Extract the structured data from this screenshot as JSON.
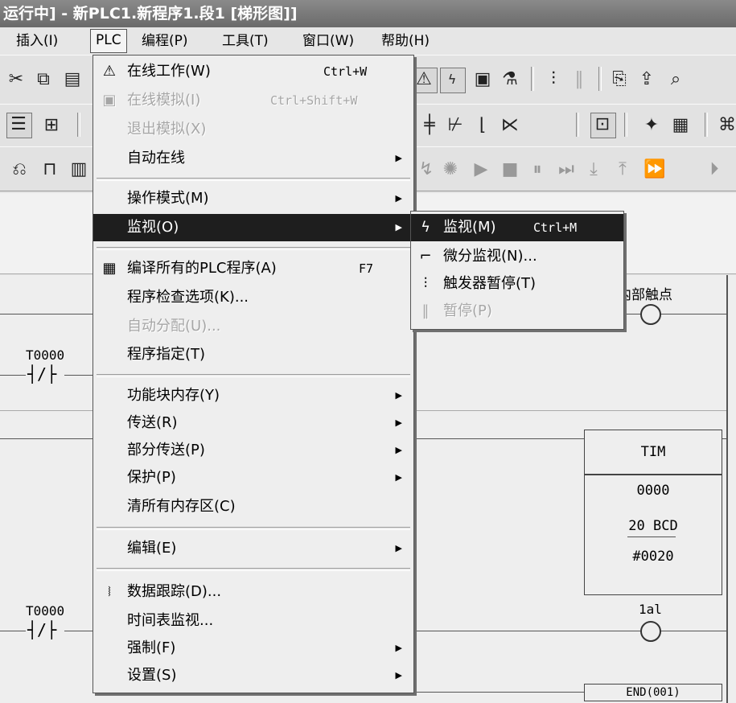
{
  "title": "运行中] - 新PLC1.新程序1.段1 [梯形图]]",
  "menubar": [
    "插入(I)",
    "PLC",
    "编程(P)",
    "工具(T)",
    "窗口(W)",
    "帮助(H)"
  ],
  "ladder": {
    "contact1": "T0000",
    "contact2": "T0000",
    "coil1": "内部触点",
    "coil2": "1al",
    "tim": {
      "name": "TIM",
      "num": "0000",
      "set": "20 BCD",
      "val": "#0020"
    },
    "end": "END(001)"
  },
  "plc_menu": [
    {
      "label": "在线工作(W)",
      "shortcut": "Ctrl+W",
      "icon": "online-work-icon",
      "disabled": false
    },
    {
      "label": "在线模拟(I)",
      "shortcut": "Ctrl+Shift+W",
      "icon": "simulate-icon",
      "disabled": true
    },
    {
      "label": "退出模拟(X)",
      "shortcut": "",
      "disabled": true
    },
    {
      "label": "自动在线",
      "submenu": true,
      "disabled": false
    },
    {
      "label": "操作模式(M)",
      "submenu": true,
      "disabled": false
    },
    {
      "label": "监视(O)",
      "submenu": true,
      "highlighted": true,
      "disabled": false
    },
    {
      "label": "编译所有的PLC程序(A)",
      "shortcut": "F7",
      "icon": "compile-icon",
      "disabled": false
    },
    {
      "label": "程序检查选项(K)...",
      "disabled": false
    },
    {
      "label": "自动分配(U)...",
      "disabled": true
    },
    {
      "label": "程序指定(T)",
      "disabled": false
    },
    {
      "label": "功能块内存(Y)",
      "submenu": true,
      "disabled": false
    },
    {
      "label": "传送(R)",
      "submenu": true,
      "disabled": false
    },
    {
      "label": "部分传送(P)",
      "submenu": true,
      "disabled": false
    },
    {
      "label": "保护(P)",
      "submenu": true,
      "disabled": false
    },
    {
      "label": "清所有内存区(C)",
      "disabled": false
    },
    {
      "label": "编辑(E)",
      "submenu": true,
      "disabled": false
    },
    {
      "label": "数据跟踪(D)...",
      "icon": "data-trace-icon",
      "disabled": false
    },
    {
      "label": "时间表监视...",
      "disabled": false
    },
    {
      "label": "强制(F)",
      "submenu": true,
      "disabled": false
    },
    {
      "label": "设置(S)",
      "submenu": true,
      "disabled": false
    }
  ],
  "monitor_submenu": [
    {
      "label": "监视(M)",
      "shortcut": "Ctrl+M",
      "icon": "monitor-icon",
      "highlighted": true,
      "disabled": false
    },
    {
      "label": "微分监视(N)...",
      "icon": "diff-monitor-icon",
      "disabled": false
    },
    {
      "label": "触发器暂停(T)",
      "icon": "trigger-pause-icon",
      "disabled": false
    },
    {
      "label": "暂停(P)",
      "icon": "pause-icon",
      "disabled": true
    }
  ]
}
